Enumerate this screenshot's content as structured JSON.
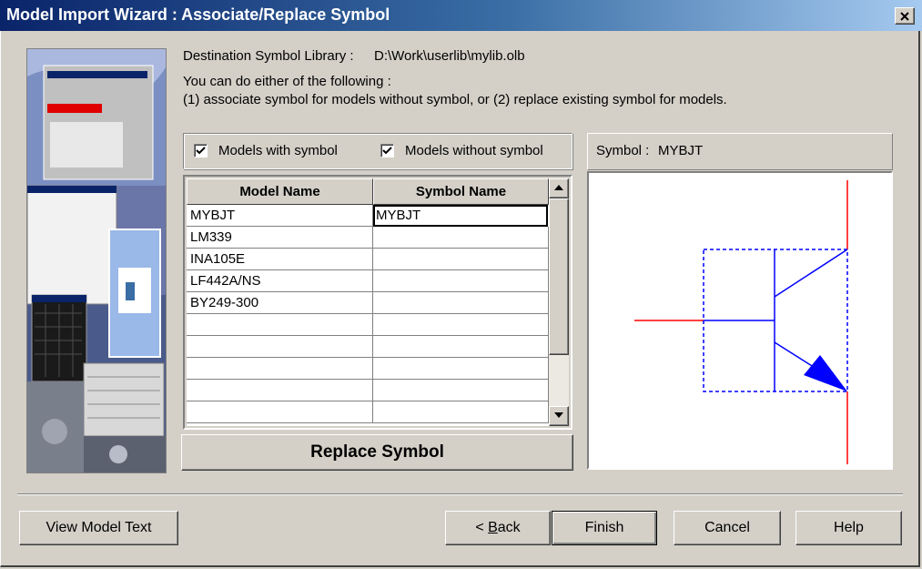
{
  "window": {
    "title": "Model Import Wizard : Associate/Replace Symbol",
    "close_icon": "close-icon"
  },
  "info": {
    "destination_label": "Destination Symbol Library :",
    "destination_path": "D:\\Work\\userlib\\mylib.olb",
    "instruction_line1": "You can do either of the following :",
    "instruction_line2": "(1) associate symbol for models without symbol, or (2) replace existing symbol for models."
  },
  "filters": {
    "with_symbol": {
      "label": "Models with symbol",
      "checked": true
    },
    "without_symbol": {
      "label": "Models without symbol",
      "checked": true
    }
  },
  "grid": {
    "columns": [
      "Model Name",
      "Symbol Name"
    ],
    "rows": [
      {
        "model": "MYBJT",
        "symbol": "MYBJT"
      },
      {
        "model": "LM339",
        "symbol": ""
      },
      {
        "model": "INA105E",
        "symbol": ""
      },
      {
        "model": "LF442A/NS",
        "symbol": ""
      },
      {
        "model": "BY249-300",
        "symbol": ""
      },
      {
        "model": "",
        "symbol": ""
      },
      {
        "model": "",
        "symbol": ""
      },
      {
        "model": "",
        "symbol": ""
      },
      {
        "model": "",
        "symbol": ""
      },
      {
        "model": "",
        "symbol": ""
      }
    ],
    "selected_row": 0,
    "scroll_up_icon": "arrow-up-icon",
    "scroll_down_icon": "arrow-down-icon"
  },
  "replace_button": "Replace Symbol",
  "symbol_preview": {
    "label": "Symbol :",
    "symbol_name": "MYBJT",
    "colors": {
      "pins": "#ff0000",
      "body": "#0000ff"
    }
  },
  "footer": {
    "view_model_text": "View Model Text",
    "back": "< Back",
    "finish": "Finish",
    "cancel": "Cancel",
    "help": "Help"
  }
}
